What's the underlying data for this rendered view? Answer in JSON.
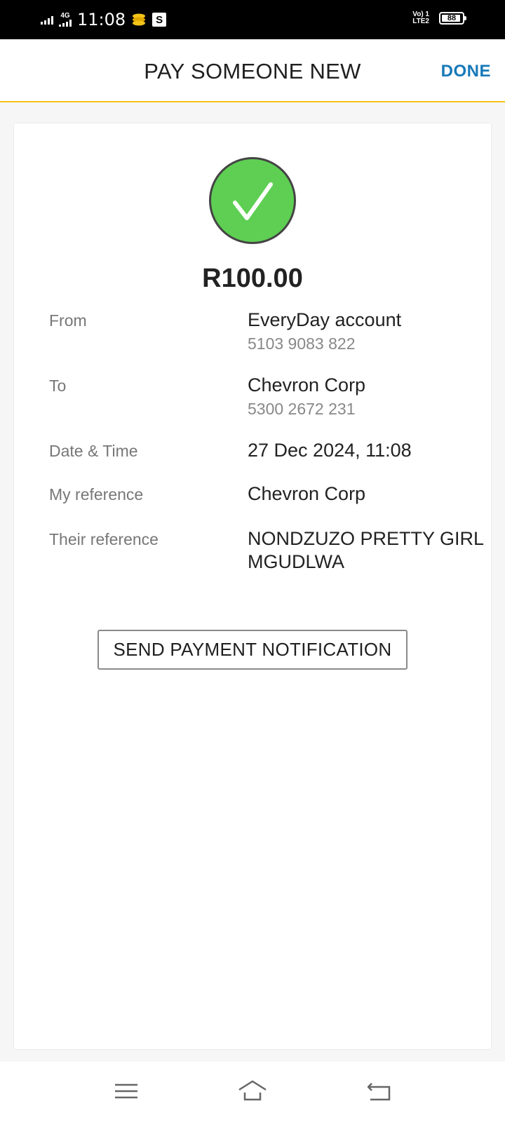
{
  "status": {
    "time": "11:08",
    "network": "4G",
    "volte": "Vo) 1",
    "lte": "LTE2",
    "battery": "88",
    "icons": [
      "signal-icon",
      "network-4g-icon",
      "app-stack-icon",
      "s-app-icon",
      "volte-icon",
      "battery-icon"
    ]
  },
  "header": {
    "title": "PAY SOMEONE NEW",
    "done_label": "DONE",
    "accent_color": "#f3c318",
    "link_color": "#1779b8"
  },
  "confirmation": {
    "icon": "check-circle-icon",
    "success_color": "#5ecf53",
    "amount": "R100.00"
  },
  "details": {
    "from_label": "From",
    "from_name": "EveryDay account",
    "from_account": "5103 9083 822",
    "to_label": "To",
    "to_name": "Chevron Corp",
    "to_account": "5300 2672 231",
    "date_label": "Date & Time",
    "date_value": "27 Dec 2024, 11:08",
    "my_ref_label": "My reference",
    "my_ref_value": "Chevron Corp",
    "their_ref_label": "Their reference",
    "their_ref_value": "NONDZUZO PRETTY GIRL MGUDLWA"
  },
  "actions": {
    "notify_label": "SEND PAYMENT NOTIFICATION"
  },
  "nav": {
    "icons": [
      "menu-icon",
      "home-icon",
      "back-icon"
    ]
  }
}
